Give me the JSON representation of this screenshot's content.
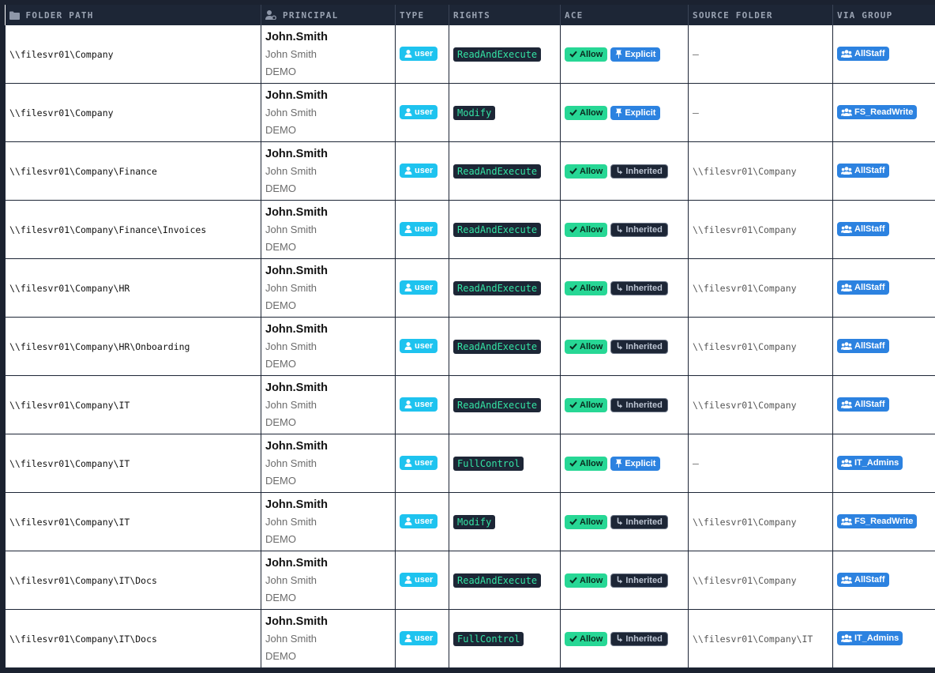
{
  "columns": {
    "folder_path": "FOLDER PATH",
    "principal": "PRINCIPAL",
    "type": "TYPE",
    "rights": "RIGHTS",
    "ace": "ACE",
    "source_folder": "SOURCE FOLDER",
    "via_group": "VIA GROUP"
  },
  "icons": {
    "folder": "folder-icon",
    "principal": "user-gear-icon",
    "user": "user-icon",
    "allow": "check-icon",
    "explicit": "pin-icon",
    "inherited": "inherit-arrow-icon",
    "group": "users-icon"
  },
  "colors": {
    "header_bg": "#1d2636",
    "type_badge": "#1ec3ef",
    "allow_badge": "#27d795",
    "explicit_badge": "#2c82e0",
    "group_badge": "#2c82e0",
    "rights_text": "#34e3a4"
  },
  "rows": [
    {
      "path": "\\\\filesvr01\\Company",
      "login": "John.Smith",
      "name": "John Smith",
      "domain": "DEMO",
      "type": "user",
      "rights": "ReadAndExecute",
      "access": "Allow",
      "inheritance": "Explicit",
      "source": "—",
      "group": "AllStaff"
    },
    {
      "path": "\\\\filesvr01\\Company",
      "login": "John.Smith",
      "name": "John Smith",
      "domain": "DEMO",
      "type": "user",
      "rights": "Modify",
      "access": "Allow",
      "inheritance": "Explicit",
      "source": "—",
      "group": "FS_ReadWrite"
    },
    {
      "path": "\\\\filesvr01\\Company\\Finance",
      "login": "John.Smith",
      "name": "John Smith",
      "domain": "DEMO",
      "type": "user",
      "rights": "ReadAndExecute",
      "access": "Allow",
      "inheritance": "Inherited",
      "source": "\\\\filesvr01\\Company",
      "group": "AllStaff"
    },
    {
      "path": "\\\\filesvr01\\Company\\Finance\\Invoices",
      "login": "John.Smith",
      "name": "John Smith",
      "domain": "DEMO",
      "type": "user",
      "rights": "ReadAndExecute",
      "access": "Allow",
      "inheritance": "Inherited",
      "source": "\\\\filesvr01\\Company",
      "group": "AllStaff"
    },
    {
      "path": "\\\\filesvr01\\Company\\HR",
      "login": "John.Smith",
      "name": "John Smith",
      "domain": "DEMO",
      "type": "user",
      "rights": "ReadAndExecute",
      "access": "Allow",
      "inheritance": "Inherited",
      "source": "\\\\filesvr01\\Company",
      "group": "AllStaff"
    },
    {
      "path": "\\\\filesvr01\\Company\\HR\\Onboarding",
      "login": "John.Smith",
      "name": "John Smith",
      "domain": "DEMO",
      "type": "user",
      "rights": "ReadAndExecute",
      "access": "Allow",
      "inheritance": "Inherited",
      "source": "\\\\filesvr01\\Company",
      "group": "AllStaff"
    },
    {
      "path": "\\\\filesvr01\\Company\\IT",
      "login": "John.Smith",
      "name": "John Smith",
      "domain": "DEMO",
      "type": "user",
      "rights": "ReadAndExecute",
      "access": "Allow",
      "inheritance": "Inherited",
      "source": "\\\\filesvr01\\Company",
      "group": "AllStaff"
    },
    {
      "path": "\\\\filesvr01\\Company\\IT",
      "login": "John.Smith",
      "name": "John Smith",
      "domain": "DEMO",
      "type": "user",
      "rights": "FullControl",
      "access": "Allow",
      "inheritance": "Explicit",
      "source": "—",
      "group": "IT_Admins"
    },
    {
      "path": "\\\\filesvr01\\Company\\IT",
      "login": "John.Smith",
      "name": "John Smith",
      "domain": "DEMO",
      "type": "user",
      "rights": "Modify",
      "access": "Allow",
      "inheritance": "Inherited",
      "source": "\\\\filesvr01\\Company",
      "group": "FS_ReadWrite"
    },
    {
      "path": "\\\\filesvr01\\Company\\IT\\Docs",
      "login": "John.Smith",
      "name": "John Smith",
      "domain": "DEMO",
      "type": "user",
      "rights": "ReadAndExecute",
      "access": "Allow",
      "inheritance": "Inherited",
      "source": "\\\\filesvr01\\Company",
      "group": "AllStaff"
    },
    {
      "path": "\\\\filesvr01\\Company\\IT\\Docs",
      "login": "John.Smith",
      "name": "John Smith",
      "domain": "DEMO",
      "type": "user",
      "rights": "FullControl",
      "access": "Allow",
      "inheritance": "Inherited",
      "source": "\\\\filesvr01\\Company\\IT",
      "group": "IT_Admins"
    }
  ]
}
